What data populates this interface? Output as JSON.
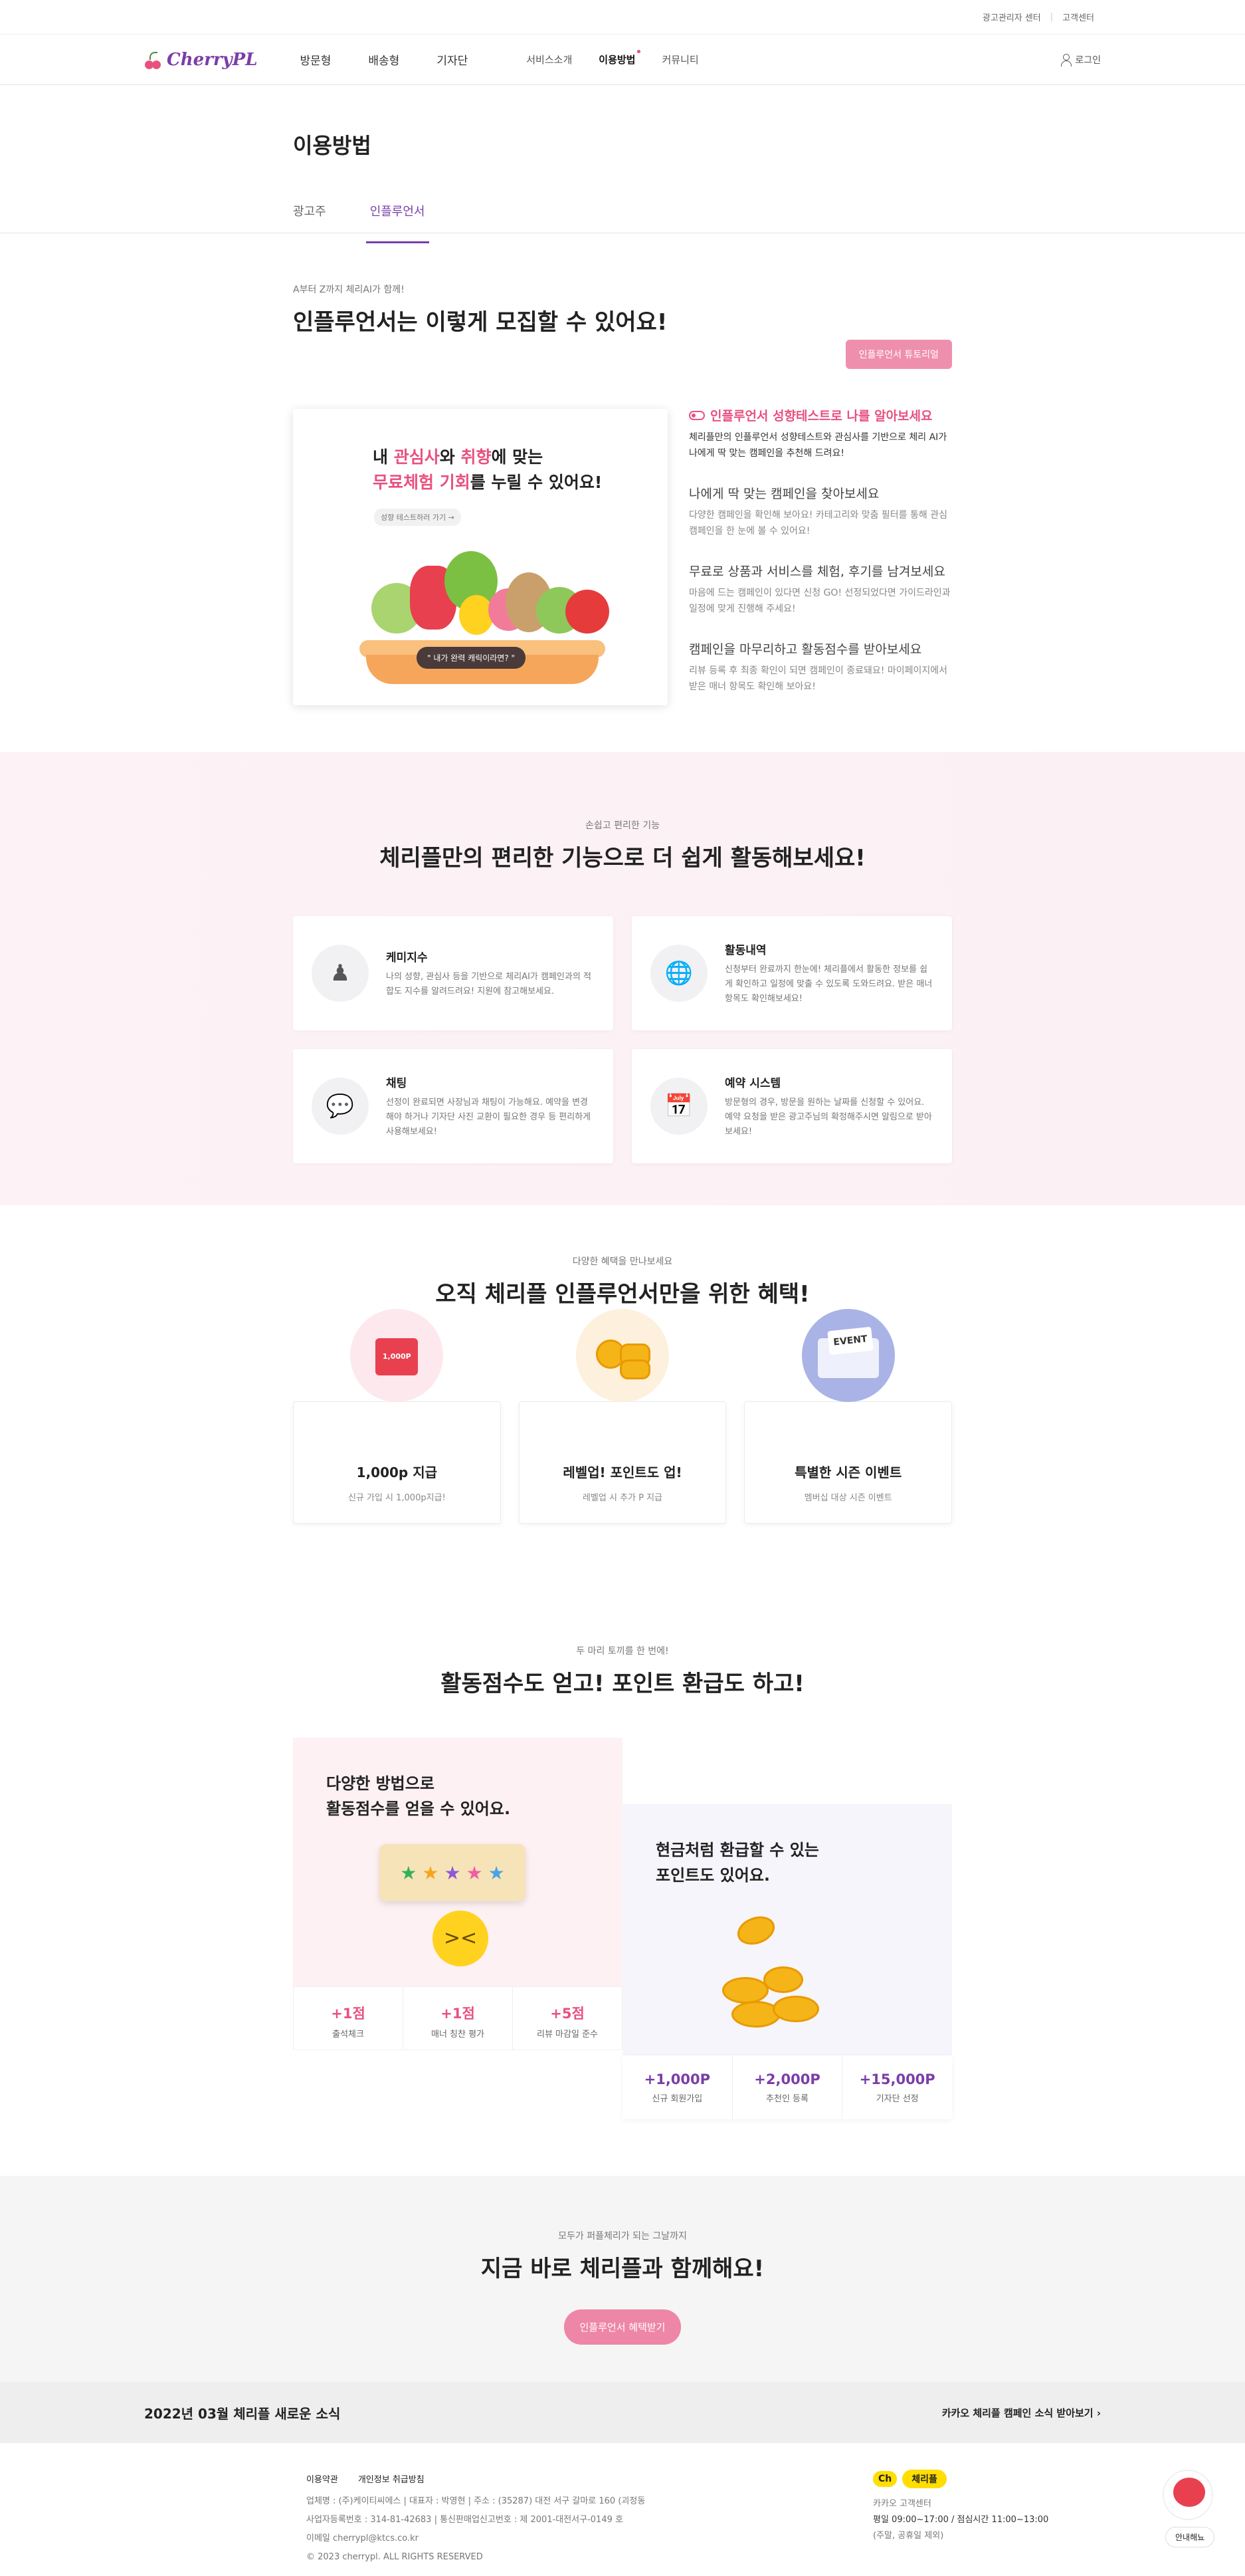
{
  "topbar": {
    "links": [
      "광고관리자 센터",
      "고객센터"
    ]
  },
  "header": {
    "logo": "CherryPL",
    "main_nav": [
      "방문형",
      "배송형",
      "기자단"
    ],
    "sub_nav": [
      "서비스소개",
      "이용방법",
      "커뮤니티"
    ],
    "login": "로그인"
  },
  "page": {
    "title": "이용방법",
    "tabs": [
      "광고주",
      "인플루언서"
    ]
  },
  "recruit": {
    "kicker": "A부터 Z까지 체리AI가 함께!",
    "title": "인플루언서는 이렇게 모집할 수 있어요!",
    "tutorial_button": "인플루언서 튜토리얼",
    "illus_line1_a": "내 ",
    "illus_line1_b": "관심사",
    "illus_line1_c": "와 ",
    "illus_line1_d": "취향",
    "illus_line1_e": "에 맞는",
    "illus_line2_a": "무료체험 기회",
    "illus_line2_b": "를 누릴 수 있어요!",
    "illus_small": "성향 테스트하러 가기 →",
    "illus_bubble": "\" 내가 완력 캐릭이라면? \"",
    "steps": [
      {
        "title": "인플루언서 성향테스트로 나를 알아보세요",
        "desc": "체리플만의 인플루언서 성향테스트와 관심사를 기반으로 체리 AI가 나에게 딱 맞는 캠페인을 추천해 드려요!"
      },
      {
        "title": "나에게 딱 맞는 캠페인을 찾아보세요",
        "desc": "다양한 캠페인을 확인해 보아요! 카테고리와 맞춤 필터를 통해 관심 캠페인을 한 눈에 볼 수 있어요!"
      },
      {
        "title": "무료로 상품과 서비스를 체험, 후기를 남겨보세요",
        "desc": "마음에 드는 캠페인이 있다면 신청 GO! 선정되었다면 가이드라인과 일정에 맞게 진행해 주세요!"
      },
      {
        "title": "캠페인을 마무리하고 활동점수를 받아보세요",
        "desc": "리뷰 등록 후 최종 확인이 되면 캠페인이 종료돼요! 마이페이지에서 받은 매너 항목도 확인해 보아요!"
      }
    ]
  },
  "features": {
    "kicker": "손쉽고 편리한 기능",
    "title": "체리플만의 편리한 기능으로 더 쉽게 활동해보세요!",
    "items": [
      {
        "icon": "people-icon",
        "title": "케미지수",
        "desc": "나의 성향, 관심사 등을 기반으로 체리AI가 캠페인과의 적합도 지수를 알려드려요! 지원에 참고해보세요."
      },
      {
        "icon": "globe-search-icon",
        "title": "활동내역",
        "desc": "신청부터 완료까지 한눈에! 체리플에서 활동한 정보를 쉽게 확인하고 일정에 맞출 수 있도록 도와드려요. 받은 매너 항목도 확인해보세요!"
      },
      {
        "icon": "chat-icon",
        "title": "채팅",
        "desc": "선정이 완료되면 사장님과 채팅이 가능해요. 예약을 변경해야 하거나 기자단 사진 교환이 필요한 경우 등 편리하게 사용해보세요!"
      },
      {
        "icon": "calendar-icon",
        "title": "예약 시스템",
        "desc": "방문형의 경우, 방문을 원하는 날짜를 신청할 수 있어요. 예약 요청을 받은 광고주님의 확정해주시면 알림으로 받아보세요!"
      }
    ]
  },
  "benefits": {
    "kicker": "다양한 혜택을 만나보세요",
    "title": "오직 체리플 인플루언서만을 위한 혜택!",
    "items": [
      {
        "icon": "gift-icon",
        "badge": "1,000P",
        "title": "1,000p 지급",
        "desc": "신규 가입 시 1,000p지급!"
      },
      {
        "icon": "coins-icon",
        "title": "레벨업! 포인트도 업!",
        "desc": "레벨업 시 추가 P 지급"
      },
      {
        "icon": "event-envelope-icon",
        "badge": "EVENT",
        "title": "특별한 시즌 이벤트",
        "desc": "멤버십 대상 시즌 이벤트"
      }
    ]
  },
  "points": {
    "kicker": "두 마리 토끼를 한 번에!",
    "title": "활동점수도 얻고! 포인트 환급도 하고!",
    "left": {
      "heading": [
        "다양한 방법으로",
        "활동점수를 얻을 수 있어요."
      ],
      "stats": [
        {
          "value": "+1점",
          "label": "출석체크"
        },
        {
          "value": "+1점",
          "label": "매너 칭찬 평가"
        },
        {
          "value": "+5점",
          "label": "리뷰 마감일 준수"
        }
      ]
    },
    "right": {
      "heading": [
        "현금처럼 환급할 수 있는",
        "포인트도 있어요."
      ],
      "stats": [
        {
          "value": "+1,000P",
          "label": "신규 회원가입"
        },
        {
          "value": "+2,000P",
          "label": "추천인 등록"
        },
        {
          "value": "+15,000P",
          "label": "기자단 선정"
        }
      ]
    }
  },
  "cta": {
    "kicker": "모두가 퍼플체리가 되는 그날까지",
    "title": "지금 바로 체리플과 함께해요!",
    "button": "인플루언서 혜택받기"
  },
  "news": {
    "left": "2022년 03월 체리플 새로운 소식",
    "right": "카카오 체리플 캠페인 소식 받아보기 ›"
  },
  "footer": {
    "links": [
      "이용약관",
      "개인정보 취급방침"
    ],
    "info": [
      "업체명 : (주)케이티씨에스  |  대표자 : 박영현  |  주소 : (35287) 대전 서구 갈마로 160 (괴정동",
      "사업자등록번호 : 314-81-42683  |  통신판매업신고번호 : 제 2001-대전서구-0149 호",
      "이메일 cherrypl@ktcs.co.kr",
      "© 2023 cherrypl. ALL RIGHTS RESERVED"
    ],
    "kakao_ch": "Ch",
    "kakao_name": "체리플",
    "cs_title": "카카오 고객센터",
    "cs_hours": "평일 09:00~17:00 / 점심시간 11:00~13:00",
    "cs_note": "(주말, 공휴일 제외)",
    "guide": "안내해뇨"
  }
}
